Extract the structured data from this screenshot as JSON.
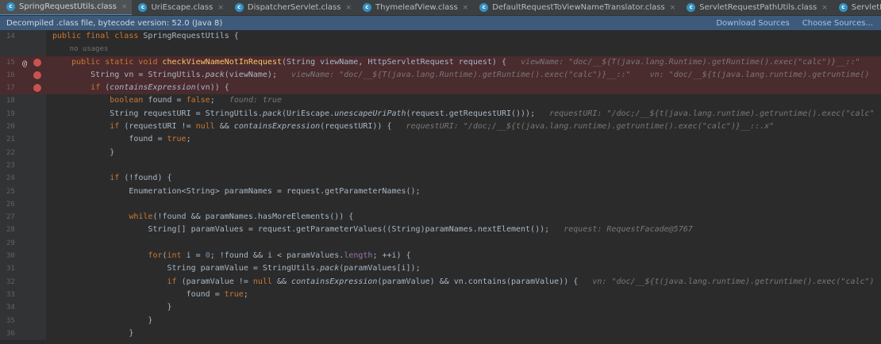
{
  "tabs": [
    {
      "label": "SpringRequestUtils.class",
      "active": true
    },
    {
      "label": "UriEscape.class",
      "active": false
    },
    {
      "label": "DispatcherServlet.class",
      "active": false
    },
    {
      "label": "ThymeleafView.class",
      "active": false
    },
    {
      "label": "DefaultRequestToViewNameTranslator.class",
      "active": false
    },
    {
      "label": "ServletRequestPathUtils.class",
      "active": false
    },
    {
      "label": "ServletInvocableHandlerMet",
      "active": false
    }
  ],
  "tab_icon_letter": "c",
  "tab_close_glyph": "×",
  "tab_overflow_glyph": "⌄",
  "banner": {
    "text": "Decompiled .class file, bytecode version: 52.0 (Java 8)",
    "download_sources": "Download Sources",
    "choose_sources": "Choose Sources..."
  },
  "colors": {
    "editor_bg": "#2b2b2b",
    "breakpoint_line_bg": "#4a2b2e",
    "banner_bg": "#3d5a7a",
    "keyword": "#cc7832",
    "method_decl": "#ffc66d",
    "inline_hint": "#787878"
  },
  "editor": {
    "lines": [
      {
        "n": "14",
        "bp": false,
        "marker": "",
        "code": [
          [
            "kw",
            "public final class "
          ],
          [
            "",
            "SpringRequestUtils {"
          ]
        ]
      },
      {
        "n": "",
        "bp": false,
        "marker": "",
        "code": [
          [
            "hint",
            "    no usages"
          ]
        ]
      },
      {
        "n": "15",
        "bp": true,
        "marker": "at-bp",
        "code": [
          [
            "",
            "    "
          ],
          [
            "kw",
            "public static void "
          ],
          [
            "fn",
            "checkViewNameNotInRequest"
          ],
          [
            "",
            "(String viewName, HttpServletRequest request) {   "
          ],
          [
            "inlay",
            "viewName: \"doc/__${T(java.lang.Runtime).getRuntime().exec(\"calc\")}__::\""
          ]
        ]
      },
      {
        "n": "16",
        "bp": true,
        "marker": "bp",
        "code": [
          [
            "",
            "        String vn = StringUtils."
          ],
          [
            "it",
            "pack"
          ],
          [
            "",
            "(viewName);   "
          ],
          [
            "inlay",
            "viewName: \"doc/__${T(java.lang.Runtime).getRuntime().exec(\"calc\")}__::\"    vn: \"doc/__${t(java.lang.runtime).getruntime()"
          ]
        ]
      },
      {
        "n": "17",
        "bp": true,
        "marker": "bp",
        "code": [
          [
            "",
            "        "
          ],
          [
            "kw",
            "if "
          ],
          [
            "",
            "("
          ],
          [
            "it",
            "containsExpression"
          ],
          [
            "",
            "(vn)) {"
          ]
        ]
      },
      {
        "n": "18",
        "bp": false,
        "marker": "",
        "code": [
          [
            "",
            "            "
          ],
          [
            "kw",
            "boolean "
          ],
          [
            "",
            "found = "
          ],
          [
            "kw",
            "false"
          ],
          [
            "",
            ";   "
          ],
          [
            "inlay",
            "found: true"
          ]
        ]
      },
      {
        "n": "19",
        "bp": false,
        "marker": "",
        "code": [
          [
            "",
            "            String requestURI = StringUtils."
          ],
          [
            "it",
            "pack"
          ],
          [
            "",
            "(UriEscape."
          ],
          [
            "it",
            "unescapeUriPath"
          ],
          [
            "",
            "(request.getRequestURI()));   "
          ],
          [
            "inlay",
            "requestURI: \"/doc;/__${t(java.lang.runtime).getruntime().exec(\"calc\""
          ]
        ]
      },
      {
        "n": "20",
        "bp": false,
        "marker": "",
        "code": [
          [
            "",
            "            "
          ],
          [
            "kw",
            "if "
          ],
          [
            "",
            "(requestURI != "
          ],
          [
            "kw",
            "null "
          ],
          [
            "",
            "&& "
          ],
          [
            "it",
            "containsExpression"
          ],
          [
            "",
            "(requestURI)) {   "
          ],
          [
            "inlay",
            "requestURI: \"/doc;/__${t(java.lang.runtime).getruntime().exec(\"calc\")}__::.x\""
          ]
        ]
      },
      {
        "n": "21",
        "bp": false,
        "marker": "",
        "code": [
          [
            "",
            "                found = "
          ],
          [
            "kw",
            "true"
          ],
          [
            "",
            ";"
          ]
        ]
      },
      {
        "n": "22",
        "bp": false,
        "marker": "",
        "code": [
          [
            "",
            "            }"
          ]
        ]
      },
      {
        "n": "23",
        "bp": false,
        "marker": "",
        "code": [
          [
            "",
            ""
          ]
        ]
      },
      {
        "n": "24",
        "bp": false,
        "marker": "",
        "code": [
          [
            "",
            "            "
          ],
          [
            "kw",
            "if "
          ],
          [
            "",
            "(!found) {"
          ]
        ]
      },
      {
        "n": "25",
        "bp": false,
        "marker": "",
        "code": [
          [
            "",
            "                Enumeration<String> paramNames = request.getParameterNames();"
          ]
        ]
      },
      {
        "n": "26",
        "bp": false,
        "marker": "",
        "code": [
          [
            "",
            ""
          ]
        ]
      },
      {
        "n": "27",
        "bp": false,
        "marker": "",
        "code": [
          [
            "",
            "                "
          ],
          [
            "kw",
            "while"
          ],
          [
            "",
            "(!found && paramNames.hasMoreElements()) {"
          ]
        ]
      },
      {
        "n": "28",
        "bp": false,
        "marker": "",
        "code": [
          [
            "",
            "                    String[] paramValues = request.getParameterValues((String)paramNames.nextElement());   "
          ],
          [
            "inlay",
            "request: RequestFacade@5767"
          ]
        ]
      },
      {
        "n": "29",
        "bp": false,
        "marker": "",
        "code": [
          [
            "",
            ""
          ]
        ]
      },
      {
        "n": "30",
        "bp": false,
        "marker": "",
        "code": [
          [
            "",
            "                    "
          ],
          [
            "kw",
            "for"
          ],
          [
            "",
            "("
          ],
          [
            "kw",
            "int "
          ],
          [
            "",
            "i = "
          ],
          [
            "num",
            "0"
          ],
          [
            "",
            "; !found && i < paramValues."
          ],
          [
            "fld",
            "length"
          ],
          [
            "",
            "; ++i) {"
          ]
        ]
      },
      {
        "n": "31",
        "bp": false,
        "marker": "",
        "code": [
          [
            "",
            "                        String paramValue = StringUtils."
          ],
          [
            "it",
            "pack"
          ],
          [
            "",
            "(paramValues[i]);"
          ]
        ]
      },
      {
        "n": "32",
        "bp": false,
        "marker": "",
        "code": [
          [
            "",
            "                        "
          ],
          [
            "kw",
            "if "
          ],
          [
            "",
            "(paramValue != "
          ],
          [
            "kw",
            "null "
          ],
          [
            "",
            "&& "
          ],
          [
            "it",
            "containsExpression"
          ],
          [
            "",
            "(paramValue) && vn.contains(paramValue)) {   "
          ],
          [
            "inlay",
            "vn: \"doc/__${t(java.lang.runtime).getruntime().exec(\"calc\")"
          ]
        ]
      },
      {
        "n": "33",
        "bp": false,
        "marker": "",
        "code": [
          [
            "",
            "                            found = "
          ],
          [
            "kw",
            "true"
          ],
          [
            "",
            ";"
          ]
        ]
      },
      {
        "n": "34",
        "bp": false,
        "marker": "",
        "code": [
          [
            "",
            "                        }"
          ]
        ]
      },
      {
        "n": "35",
        "bp": false,
        "marker": "",
        "code": [
          [
            "",
            "                    }"
          ]
        ]
      },
      {
        "n": "36",
        "bp": false,
        "marker": "",
        "code": [
          [
            "",
            "                }"
          ]
        ]
      }
    ]
  }
}
